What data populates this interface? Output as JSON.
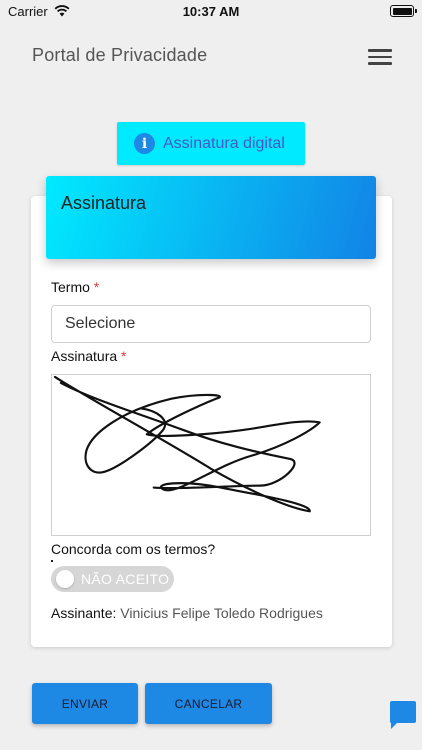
{
  "status_bar": {
    "carrier": "Carrier",
    "time": "10:37 AM",
    "battery_level": 1.0
  },
  "header": {
    "title": "Portal de Privacidade",
    "menu_icon": "hamburger-menu-icon"
  },
  "info_chip": {
    "icon": "info-icon",
    "icon_glyph": "i",
    "label": "Assinatura digital",
    "background": "#00eaff"
  },
  "card": {
    "title": "Assinatura",
    "term": {
      "label": "Termo",
      "required_mark": "*",
      "value": "Selecione"
    },
    "signature": {
      "label": "Assinatura",
      "required_mark": "*"
    },
    "agree": {
      "question": "Concorda com os termos?",
      "toggle_label": "NÃO ACEITO",
      "checked": false
    },
    "signer": {
      "label": "Assinante:",
      "name": "Vinicius Felipe Toledo Rodrigues"
    }
  },
  "actions": {
    "send_label": "ENVIAR",
    "cancel_label": "CANCELAR"
  },
  "colors": {
    "accent": "#1e88e5",
    "gradient_start": "#00eaff",
    "gradient_end": "#1283e6",
    "required": "#e53935"
  },
  "chat_fab": {
    "icon": "chat-bubble-icon"
  }
}
